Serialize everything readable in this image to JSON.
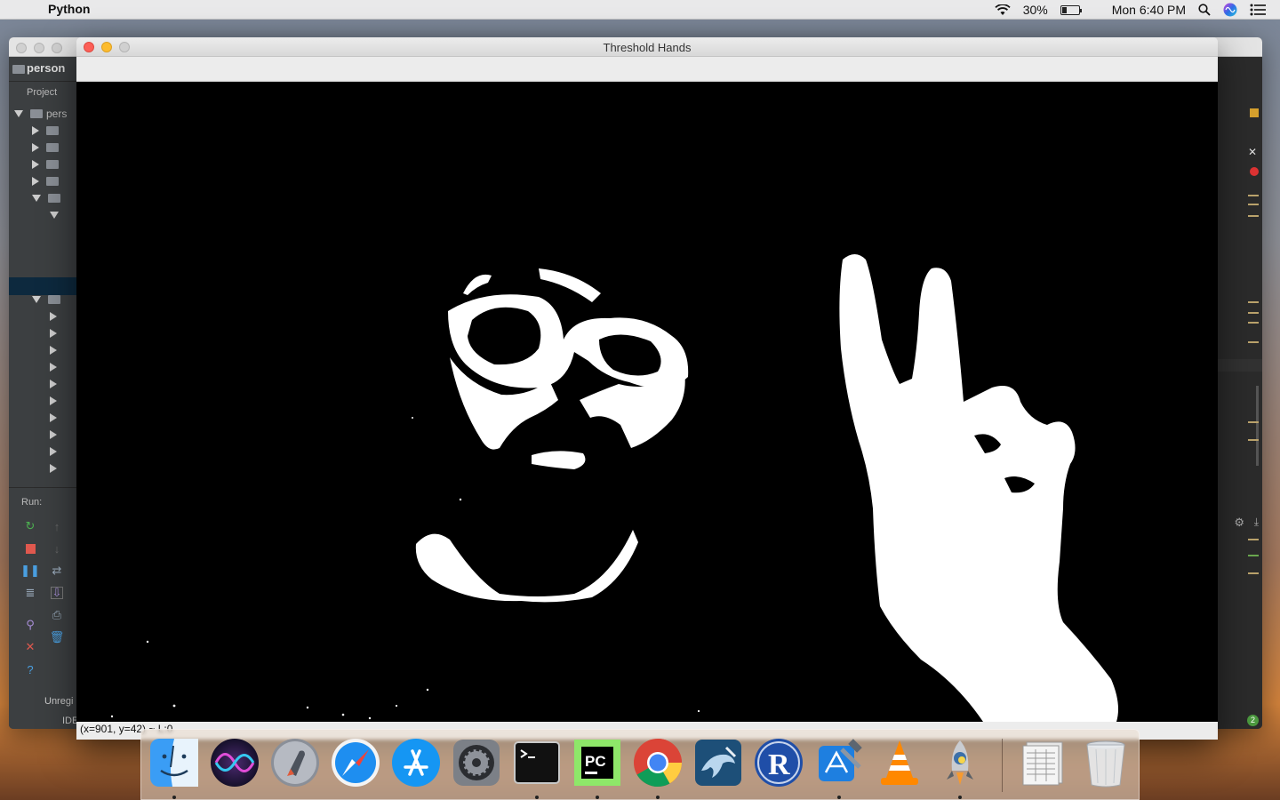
{
  "menubar": {
    "apple_glyph": "",
    "app_name": "Python",
    "battery_percent": "30%",
    "battery_level": 0.3,
    "clock": "Mon 6:40 PM"
  },
  "ide": {
    "project_label": "person",
    "project_tab": "Project",
    "tree_root": "pers",
    "run_label": "Run:",
    "status_left": "Unregi",
    "status_bottom": "IDE",
    "badge_count": "2"
  },
  "cv_window": {
    "title": "Threshold Hands",
    "status": "(x=901, y=42) ~ L:0"
  },
  "dock": {
    "items": [
      {
        "name": "finder",
        "label": "Finder",
        "running": true
      },
      {
        "name": "siri",
        "label": "Siri",
        "running": false
      },
      {
        "name": "launchpad",
        "label": "Launchpad",
        "running": false
      },
      {
        "name": "safari",
        "label": "Safari",
        "running": false
      },
      {
        "name": "app-store",
        "label": "App Store",
        "running": false
      },
      {
        "name": "system-preferences",
        "label": "System Preferences",
        "running": false
      },
      {
        "name": "terminal",
        "label": "Terminal",
        "running": true
      },
      {
        "name": "pycharm",
        "label": "PyCharm",
        "running": true
      },
      {
        "name": "chrome",
        "label": "Google Chrome",
        "running": true
      },
      {
        "name": "mysql-workbench",
        "label": "MySQLWorkbench",
        "running": false
      },
      {
        "name": "r",
        "label": "R",
        "running": false
      },
      {
        "name": "xcode",
        "label": "Xcode",
        "running": true
      },
      {
        "name": "vlc",
        "label": "VLC",
        "running": false
      },
      {
        "name": "python-launcher",
        "label": "Python",
        "running": true
      },
      {
        "name": "documents-stack",
        "label": "Documents",
        "running": false
      },
      {
        "name": "trash",
        "label": "Trash",
        "running": false
      }
    ]
  }
}
